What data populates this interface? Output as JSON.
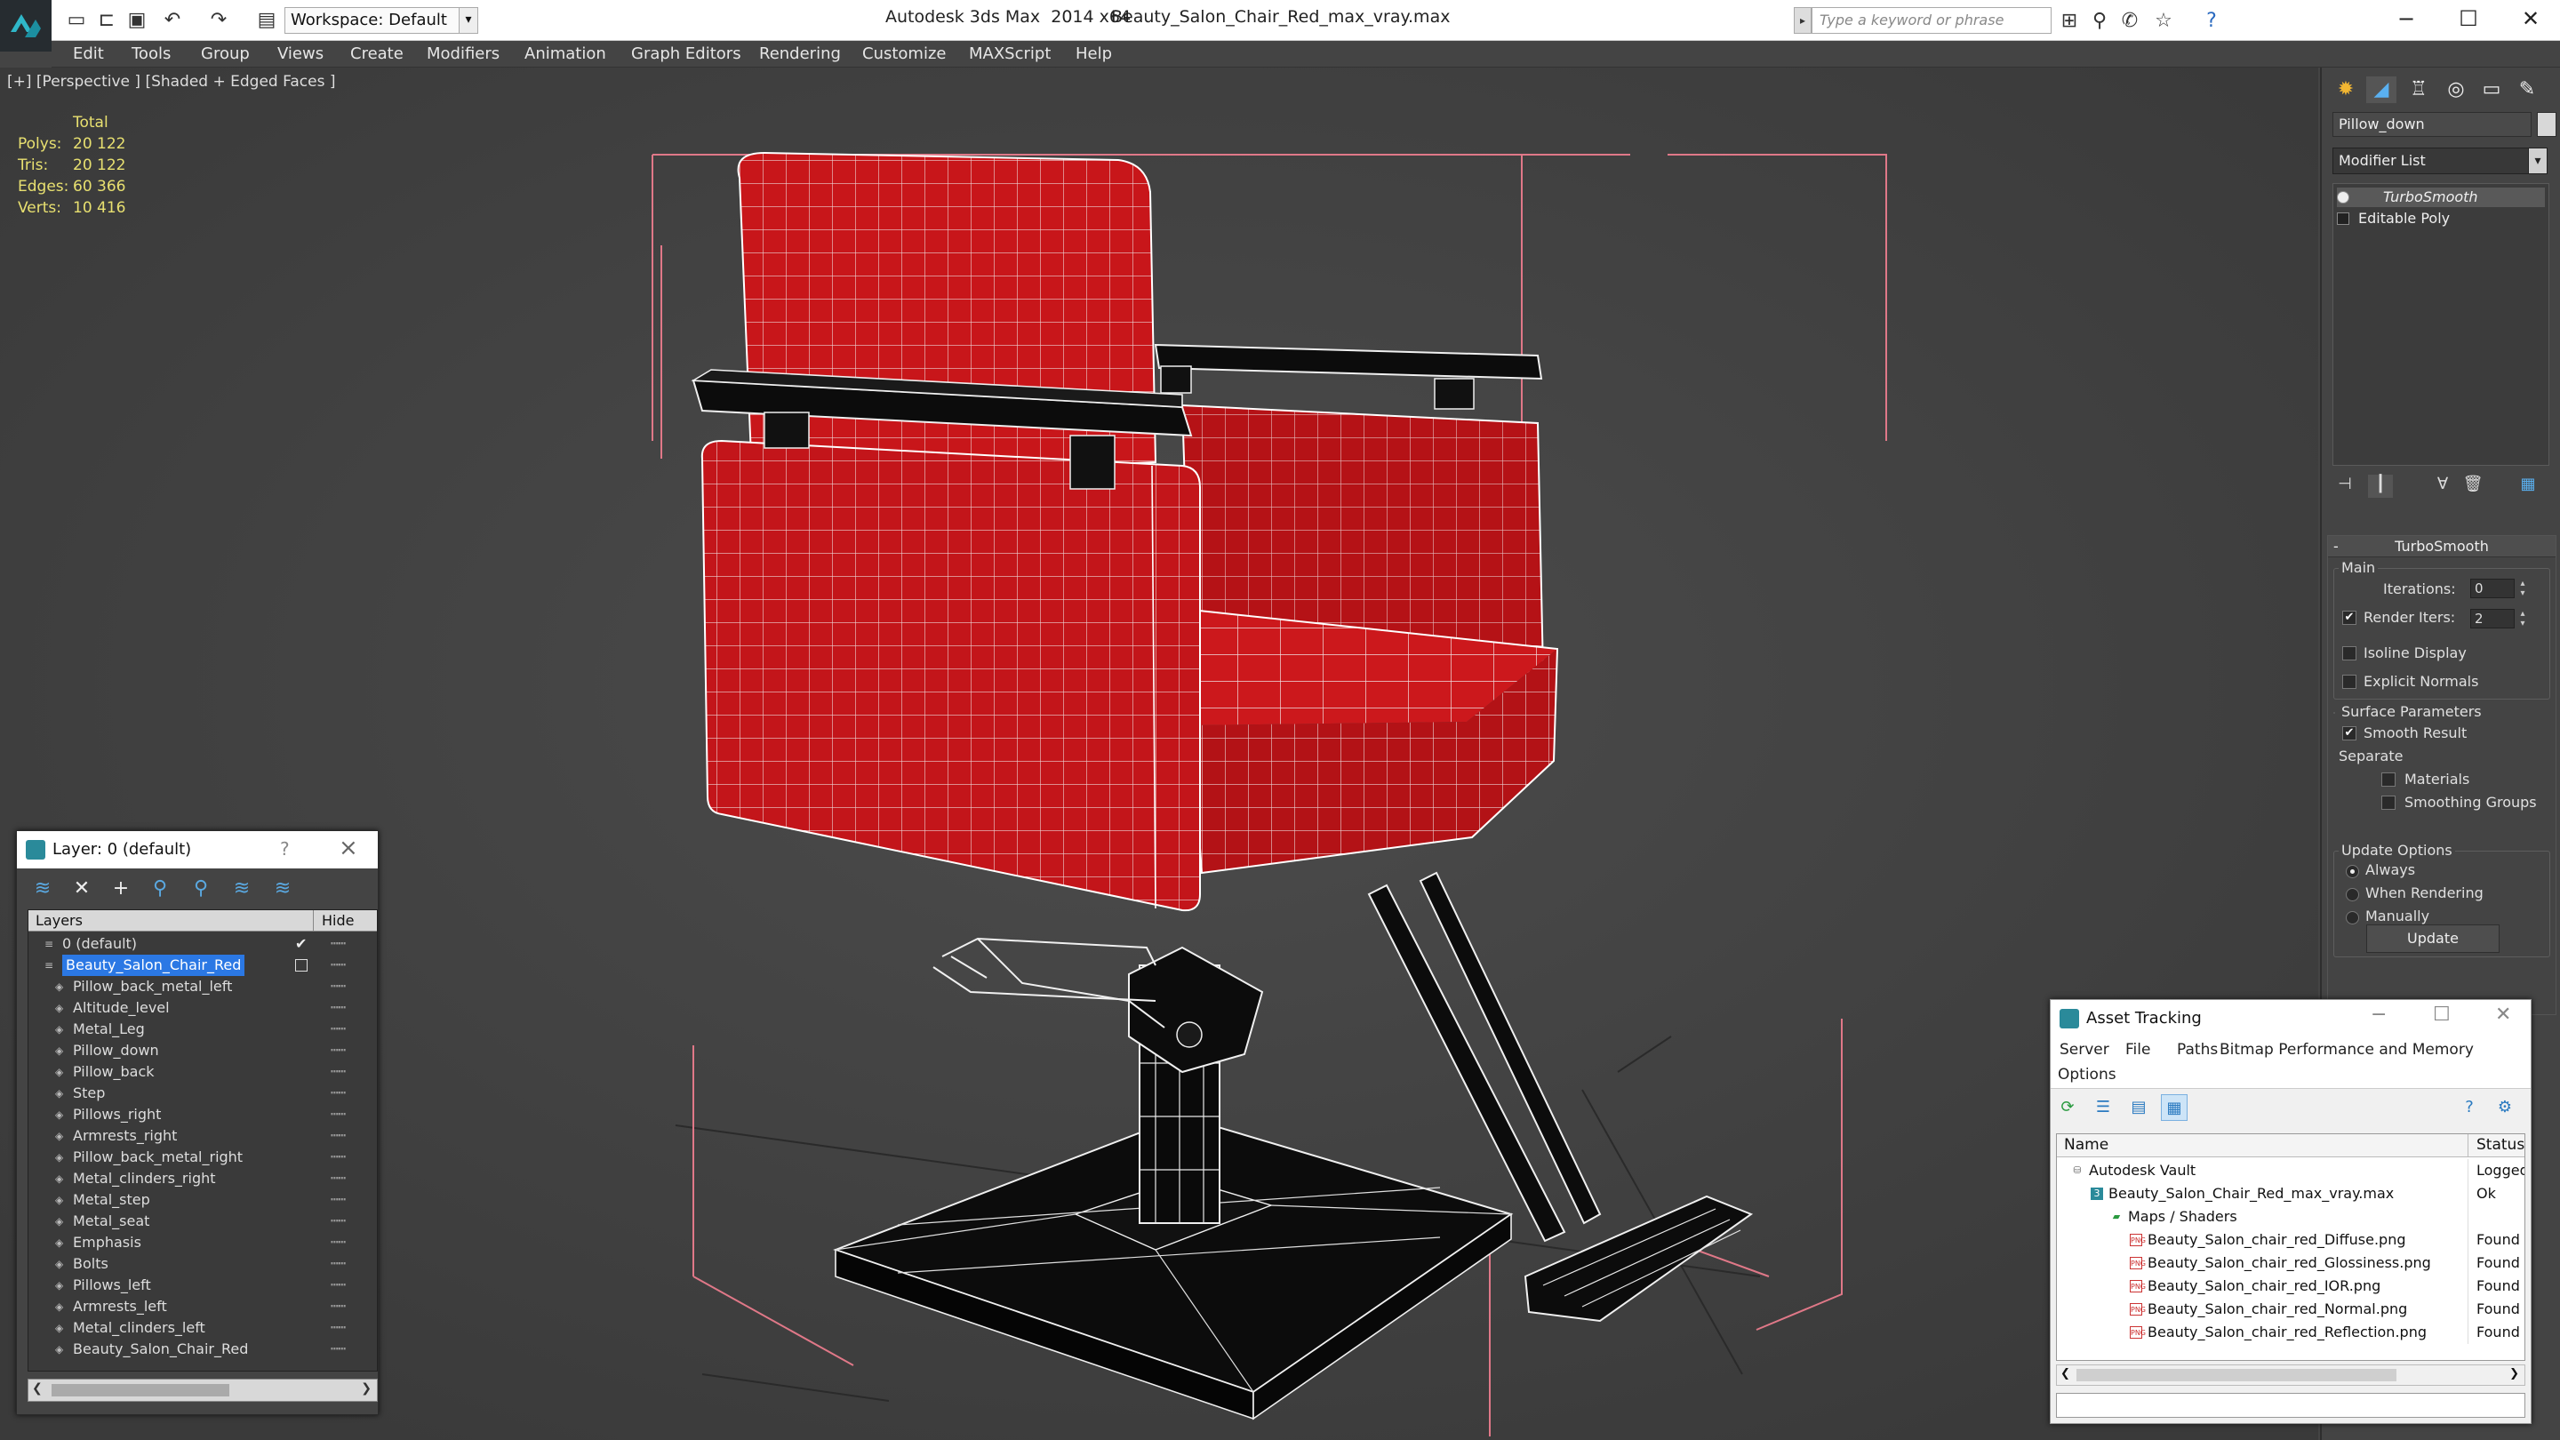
{
  "app": {
    "title": "Autodesk 3ds Max  2014 x64",
    "file": "Beauty_Salon_Chair_Red_max_vray.max",
    "workspace": "Workspace: Default",
    "search_placeholder": "Type a keyword or phrase"
  },
  "menu": [
    "Edit",
    "Tools",
    "Group",
    "Views",
    "Create",
    "Modifiers",
    "Animation",
    "Graph Editors",
    "Rendering",
    "Customize",
    "MAXScript",
    "Help"
  ],
  "viewport": {
    "label": "[+] [Perspective ] [Shaded + Edged Faces ]",
    "stats": {
      "header": "Total",
      "rows": [
        {
          "key": "Polys:",
          "value": "20 122"
        },
        {
          "key": "Tris:",
          "value": "20 122"
        },
        {
          "key": "Edges:",
          "value": "60 366"
        },
        {
          "key": "Verts:",
          "value": "10 416"
        }
      ]
    }
  },
  "command_panel": {
    "object_name": "Pillow_down",
    "modifier_list": "Modifier List",
    "stack": [
      "TurboSmooth",
      "Editable Poly"
    ],
    "turbosmooth": {
      "title": "TurboSmooth",
      "main": "Main",
      "iterations_label": "Iterations:",
      "iterations": "0",
      "render_iters_label": "Render Iters:",
      "render_iters": "2",
      "render_iters_checked": true,
      "isoline": "Isoline Display",
      "explicit": "Explicit Normals",
      "surface": "Surface Parameters",
      "smooth_result": "Smooth Result",
      "smooth_checked": true,
      "separate": "Separate",
      "materials": "Materials",
      "smoothing_groups": "Smoothing Groups",
      "update_options": "Update Options",
      "always": "Always",
      "when_rendering": "When Rendering",
      "manually": "Manually",
      "update_button": "Update"
    }
  },
  "layer_window": {
    "title": "Layer: 0 (default)",
    "help": "?",
    "col_layers": "Layers",
    "col_hide": "Hide",
    "rows": [
      {
        "name": "0 (default)",
        "level": 0,
        "check": true
      },
      {
        "name": "Beauty_Salon_Chair_Red",
        "level": 0,
        "selected": true
      },
      {
        "name": "Pillow_back_metal_left",
        "level": 1
      },
      {
        "name": "Altitude_level",
        "level": 1
      },
      {
        "name": "Metal_Leg",
        "level": 1
      },
      {
        "name": "Pillow_down",
        "level": 1
      },
      {
        "name": "Pillow_back",
        "level": 1
      },
      {
        "name": "Step",
        "level": 1
      },
      {
        "name": "Pillows_right",
        "level": 1
      },
      {
        "name": "Armrests_right",
        "level": 1
      },
      {
        "name": "Pillow_back_metal_right",
        "level": 1
      },
      {
        "name": "Metal_clinders_right",
        "level": 1
      },
      {
        "name": "Metal_step",
        "level": 1
      },
      {
        "name": "Metal_seat",
        "level": 1
      },
      {
        "name": "Emphasis",
        "level": 1
      },
      {
        "name": "Bolts",
        "level": 1
      },
      {
        "name": "Pillows_left",
        "level": 1
      },
      {
        "name": "Armrests_left",
        "level": 1
      },
      {
        "name": "Metal_clinders_left",
        "level": 1
      },
      {
        "name": "Beauty_Salon_Chair_Red",
        "level": 1
      }
    ]
  },
  "asset_tracking": {
    "title": "Asset Tracking",
    "menu": [
      "Server",
      "File",
      "Paths",
      "Bitmap Performance and Memory",
      "Options"
    ],
    "col_name": "Name",
    "col_status": "Status",
    "rows": [
      {
        "name": "Autodesk Vault",
        "status": "Logged O",
        "level": 0,
        "kind": "vault"
      },
      {
        "name": "Beauty_Salon_Chair_Red_max_vray.max",
        "status": "Ok",
        "level": 1,
        "kind": "max"
      },
      {
        "name": "Maps / Shaders",
        "status": "",
        "level": 2,
        "kind": "maps"
      },
      {
        "name": "Beauty_Salon_chair_red_Diffuse.png",
        "status": "Found",
        "level": 3,
        "kind": "file"
      },
      {
        "name": "Beauty_Salon_chair_red_Glossiness.png",
        "status": "Found",
        "level": 3,
        "kind": "file"
      },
      {
        "name": "Beauty_Salon_chair_red_IOR.png",
        "status": "Found",
        "level": 3,
        "kind": "file"
      },
      {
        "name": "Beauty_Salon_chair_red_Normal.png",
        "status": "Found",
        "level": 3,
        "kind": "file"
      },
      {
        "name": "Beauty_Salon_chair_red_Reflection.png",
        "status": "Found",
        "level": 3,
        "kind": "file"
      }
    ]
  },
  "colors": {
    "chair_red": "#c8161a",
    "wire_white": "#ffffff",
    "bbox_pink": "#e07888",
    "selection_blue": "#2b78e4",
    "stats_yellow": "#e8e070"
  }
}
